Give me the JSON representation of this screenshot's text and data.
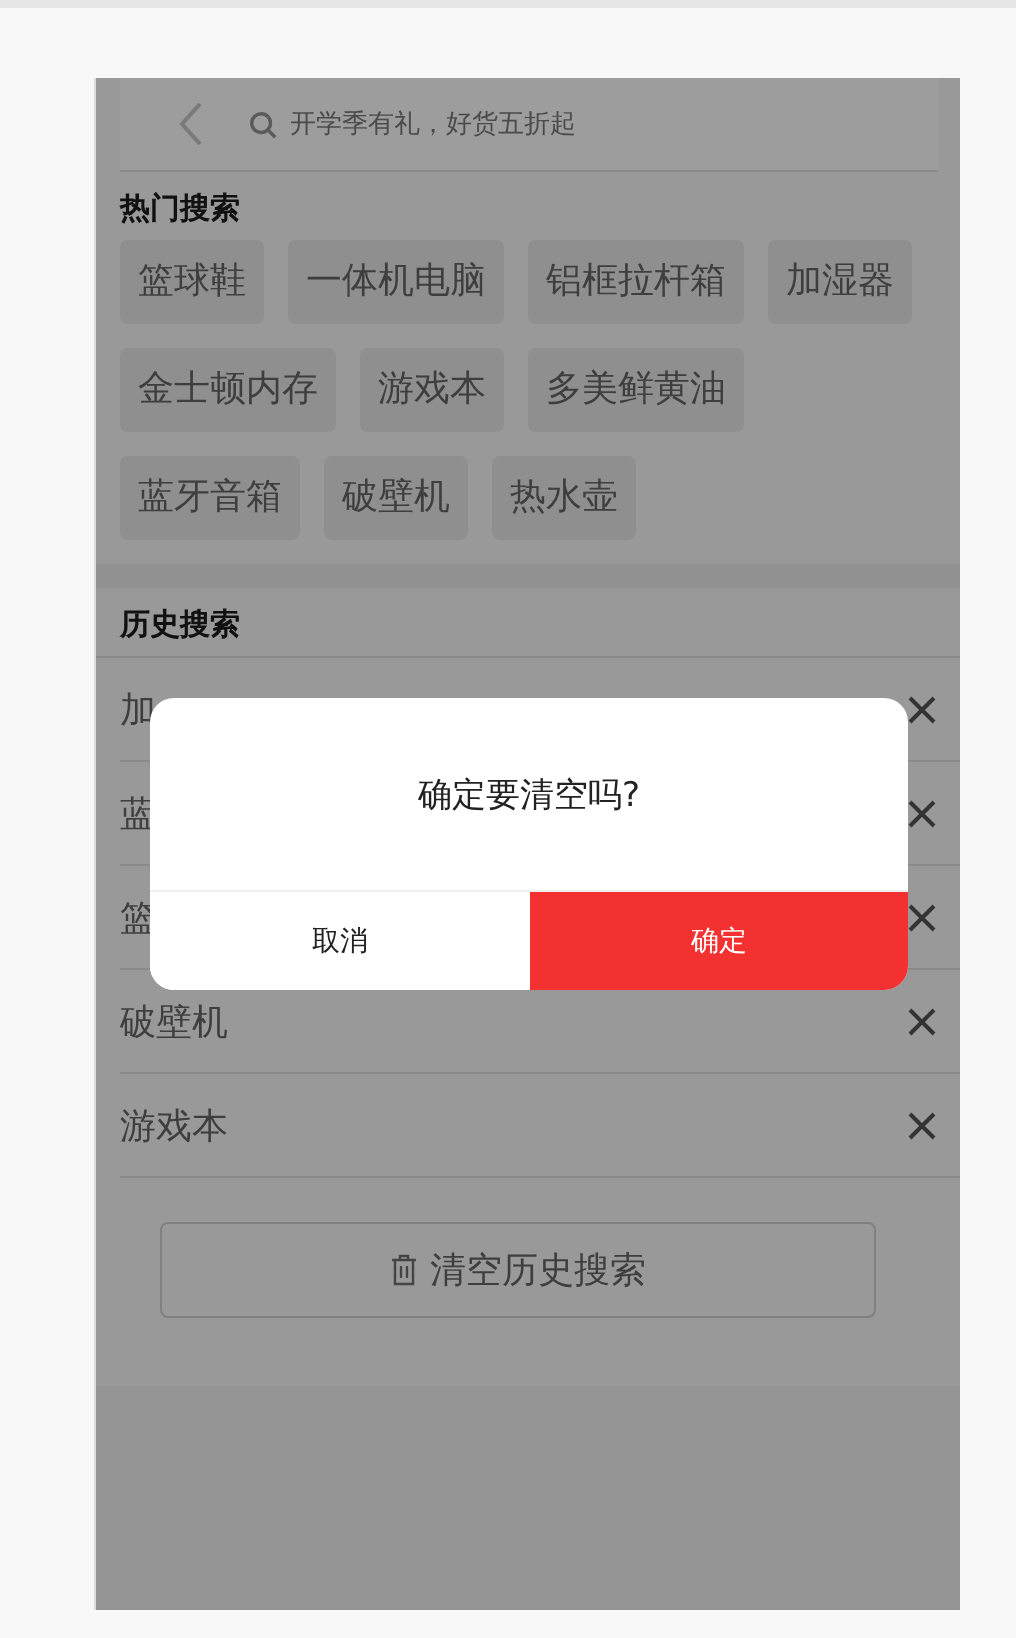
{
  "search_bar": {
    "placeholder": "开学季有礼，好货五折起"
  },
  "hot_search": {
    "title": "热门搜索",
    "tags": [
      "篮球鞋",
      "一体机电脑",
      "铝框拉杆箱",
      "加湿器",
      "金士顿内存",
      "游戏本",
      "多美鲜黄油",
      "蓝牙音箱",
      "破壁机",
      "热水壶"
    ]
  },
  "history": {
    "title": "历史搜索",
    "items": [
      "加",
      "蓝",
      "篮",
      "破壁机",
      "游戏本"
    ],
    "clear_button": "清空历史搜索"
  },
  "dialog": {
    "message": "确定要清空吗?",
    "buttons": [
      {
        "label": "取消",
        "kind": "cancel"
      },
      {
        "label": "确定",
        "kind": "confirm"
      }
    ]
  }
}
